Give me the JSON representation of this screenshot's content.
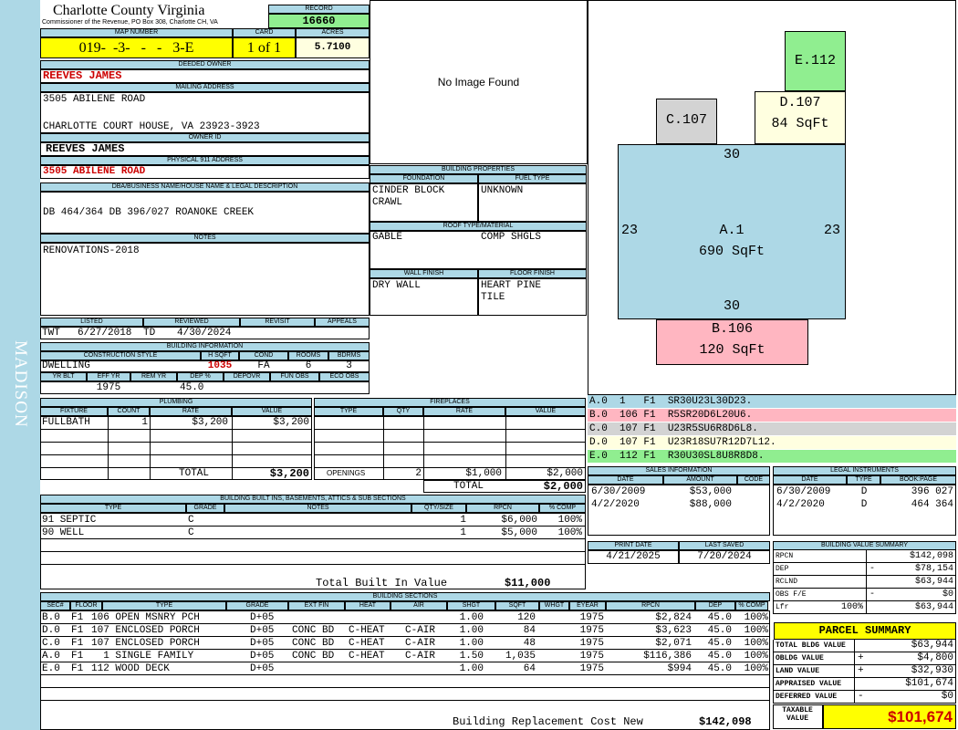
{
  "sidebar": {
    "text": "MADISON"
  },
  "header": {
    "county": "Charlotte County Virginia",
    "commissioner": "Commissioner of the Revenue, PO Box 308, Charlotte CH, VA",
    "record_label": "RECORD",
    "record": "16660",
    "map_number_label": "MAP NUMBER",
    "map_number": "019-  -3-   -   -   3-E",
    "card_label": "CARD",
    "card": "1 of 1",
    "acres_label": "ACRES",
    "acres": "5.7100"
  },
  "owner": {
    "deeded_label": "DEEDED OWNER",
    "deeded": "REEVES JAMES",
    "mailing_label": "MAILING ADDRESS",
    "mail1": "3505 ABILENE ROAD",
    "mail2": "CHARLOTTE COURT HOUSE, VA 23923-3923",
    "owner_id_label": "OWNER ID",
    "owner_id": "REEVES JAMES",
    "physical_label": "PHYSICAL 911 ADDRESS",
    "physical": "3505 ABILENE ROAD"
  },
  "legal": {
    "label": "DBA/BUSINESS NAME/HOUSE NAME & LEGAL DESCRIPTION",
    "text": "DB 464/364 DB 396/027 ROANOKE CREEK"
  },
  "notes": {
    "label": "NOTES",
    "text": "RENOVATIONS-2018"
  },
  "listed": {
    "listed_label": "LISTED",
    "reviewed_label": "REVIEWED",
    "revisit_label": "REVISIT",
    "appeals_label": "APPEALS",
    "listed_by": "TWT",
    "listed_date": "6/27/2018",
    "reviewed_by": "TD",
    "reviewed_date": "4/30/2024"
  },
  "building_info": {
    "label": "BUILDING INFORMATION",
    "h_style": "CONSTRUCTION STYLE",
    "h_hsqft": "H SQFT",
    "h_cond": "COND",
    "h_rooms": "ROOMS",
    "h_bdrms": "BDRMS",
    "style": "DWELLING",
    "hsqft": "1035",
    "cond": "FA",
    "rooms": "6",
    "bdrms": "3",
    "h_yrblt": "YR BLT",
    "h_effyr": "EFF YR",
    "h_remyr": "REM YR",
    "h_dep": "DEP %",
    "h_depovr": "DEPOVR",
    "h_funobs": "FUN OBS",
    "h_ecoobs": "ECO OBS",
    "effyr": "1975",
    "dep": "45.0"
  },
  "image": {
    "text": "No Image Found"
  },
  "building_props": {
    "label": "BUILDING PROPERTIES",
    "foundation_label": "FOUNDATION",
    "foundation1": "CINDER BLOCK",
    "foundation2": "CRAWL",
    "fuel_label": "FUEL TYPE",
    "fuel": "UNKNOWN",
    "roof_label": "ROOF TYPE/MATERIAL",
    "roof1": "GABLE",
    "roof2": "COMP SHGLS",
    "wall_label": "WALL FINISH",
    "wall": "DRY WALL",
    "floor_label": "FLOOR FINISH",
    "floor1": "HEART PINE",
    "floor2": "TILE"
  },
  "sketch": {
    "a_name": "A.1",
    "a_area": "690 SqFt",
    "top": "30",
    "bottom": "30",
    "left": "23",
    "right": "23",
    "b_name": "B.106",
    "b_area": "120 SqFt",
    "c_name": "C.107",
    "d_name": "D.107",
    "d_area": "84 SqFt",
    "e_name": "E.112"
  },
  "sketch_codes": [
    {
      "text": "A.0  1   F1  SR30U23L30D23.",
      "color": "#add8e6"
    },
    {
      "text": "B.0  106 F1  R5SR20D6L20U6.",
      "color": "#ffb6c1"
    },
    {
      "text": "C.0  107 F1  U23R5SU6R8D6L8.",
      "color": "#d3d3d3"
    },
    {
      "text": "D.0  107 F1  U23R18SU7R12D7L12.",
      "color": "#ffffe0"
    },
    {
      "text": "E.0  112 F1  R30U30SL8U8R8D8.",
      "color": "#90ee90"
    }
  ],
  "plumbing": {
    "label": "PLUMBING",
    "h_fixture": "FIXTURE",
    "h_count": "COUNT",
    "h_rate": "RATE",
    "h_value": "VALUE",
    "rows": [
      {
        "fixture": "FULLBATH",
        "count": "1",
        "rate": "$3,200",
        "value": "$3,200"
      }
    ],
    "total_label": "TOTAL",
    "total": "$3,200"
  },
  "fireplaces": {
    "label": "FIREPLACES",
    "h_type": "TYPE",
    "h_qty": "QTY",
    "h_rate": "RATE",
    "h_value": "VALUE",
    "openings_label": "OPENINGS",
    "openings_qty": "2",
    "openings_rate": "$1,000",
    "openings_value": "$2,000",
    "total_label": "TOTAL",
    "total": "$2,000"
  },
  "sales": {
    "label": "SALES INFORMATION",
    "h_date": "DATE",
    "h_amount": "AMOUNT",
    "h_code": "CODE",
    "rows": [
      {
        "date": "6/30/2009",
        "amount": "$53,000",
        "code": ""
      },
      {
        "date": "4/2/2020",
        "amount": "$88,000",
        "code": ""
      }
    ]
  },
  "legal_instruments": {
    "label": "LEGAL INSTRUMENTS",
    "h_date": "DATE",
    "h_type": "TYPE",
    "h_book": "BOOK:PAGE",
    "rows": [
      {
        "date": "6/30/2009",
        "type": "D",
        "book": "396 027"
      },
      {
        "date": "4/2/2020",
        "type": "D",
        "book": "464 364"
      }
    ]
  },
  "builtins": {
    "label": "BUILDING BUILT INS, BASEMENTS, ATTICS & SUB SECTIONS",
    "h_type": "TYPE",
    "h_grade": "GRADE",
    "h_notes": "NOTES",
    "h_qty": "QTY/SIZE",
    "h_rpcn": "RPCN",
    "h_comp": "% COMP",
    "rows": [
      {
        "type": "91 SEPTIC",
        "grade": "C",
        "notes": "",
        "qty": "1",
        "rpcn": "$6,000",
        "comp": "100%"
      },
      {
        "type": "90 WELL",
        "grade": "C",
        "notes": "",
        "qty": "1",
        "rpcn": "$5,000",
        "comp": "100%"
      }
    ],
    "total_label": "Total Built In Value",
    "total": "$11,000"
  },
  "print": {
    "print_label": "PRINT DATE",
    "saved_label": "LAST SAVED",
    "print_date": "4/21/2025",
    "saved_date": "7/20/2024"
  },
  "value_summary": {
    "label": "BUILDING VALUE SUMMARY",
    "rows": [
      {
        "label": "RPCN",
        "sign": "",
        "value": "$142,098"
      },
      {
        "label": "DEP",
        "sign": "-",
        "value": "$78,154"
      },
      {
        "label": "RCLND",
        "sign": "",
        "value": "$63,944"
      },
      {
        "label": "OBS F/E",
        "sign": "-",
        "value": "$0"
      },
      {
        "label": "Lfr",
        "pct": "100%",
        "sign": "",
        "value": "$63,944"
      }
    ]
  },
  "parcel": {
    "label": "PARCEL SUMMARY",
    "rows": [
      {
        "label": "TOTAL BLDG VALUE",
        "sign": "",
        "value": "$63,944"
      },
      {
        "label": "OBLDG VALUE",
        "sign": "+",
        "value": "$4,800"
      },
      {
        "label": "LAND VALUE",
        "sign": "+",
        "value": "$32,930"
      },
      {
        "label": "APPRAISED VALUE",
        "sign": "",
        "value": "$101,674"
      },
      {
        "label": "DEFERRED VALUE",
        "sign": "-",
        "value": "$0"
      }
    ],
    "taxable_label": "TAXABLE VALUE",
    "taxable": "$101,674"
  },
  "sections": {
    "label": "BUILDING SECTIONS",
    "headers": [
      "SEC#",
      "FLOOR",
      "TYPE",
      "GRADE",
      "EXT FIN",
      "HEAT",
      "AIR",
      "SHGT",
      "SQFT",
      "WHGT",
      "EYEAR",
      "RPCN",
      "DEP",
      "% COMP"
    ],
    "rows": [
      {
        "sec": "B.0",
        "floor": "F1",
        "type": "106 OPEN MSNRY PCH",
        "grade": "D+05",
        "ext": "",
        "heat": "",
        "air": "",
        "shgt": "1.00",
        "sqft": "120",
        "whgt": "",
        "eyear": "1975",
        "rpcn": "$2,824",
        "dep": "45.0",
        "comp": "100%"
      },
      {
        "sec": "D.0",
        "floor": "F1",
        "type": "107 ENCLOSED PORCH",
        "grade": "D+05",
        "ext": "CONC BD",
        "heat": "C-HEAT",
        "air": "C-AIR",
        "shgt": "1.00",
        "sqft": "84",
        "whgt": "",
        "eyear": "1975",
        "rpcn": "$3,623",
        "dep": "45.0",
        "comp": "100%"
      },
      {
        "sec": "C.0",
        "floor": "F1",
        "type": "107 ENCLOSED PORCH",
        "grade": "D+05",
        "ext": "CONC BD",
        "heat": "C-HEAT",
        "air": "C-AIR",
        "shgt": "1.00",
        "sqft": "48",
        "whgt": "",
        "eyear": "1975",
        "rpcn": "$2,071",
        "dep": "45.0",
        "comp": "100%"
      },
      {
        "sec": "A.0",
        "floor": "F1",
        "type": "  1 SINGLE FAMILY",
        "grade": "D+05",
        "ext": "CONC BD",
        "heat": "C-HEAT",
        "air": "C-AIR",
        "shgt": "1.50",
        "sqft": "1,035",
        "whgt": "",
        "eyear": "1975",
        "rpcn": "$116,386",
        "dep": "45.0",
        "comp": "100%"
      },
      {
        "sec": "E.0",
        "floor": "F1",
        "type": "112 WOOD DECK",
        "grade": "D+05",
        "ext": "",
        "heat": "",
        "air": "",
        "shgt": "1.00",
        "sqft": "64",
        "whgt": "",
        "eyear": "1975",
        "rpcn": "$994",
        "dep": "45.0",
        "comp": "100%"
      }
    ],
    "total_label": "Building Replacement Cost New",
    "total": "$142,098"
  }
}
